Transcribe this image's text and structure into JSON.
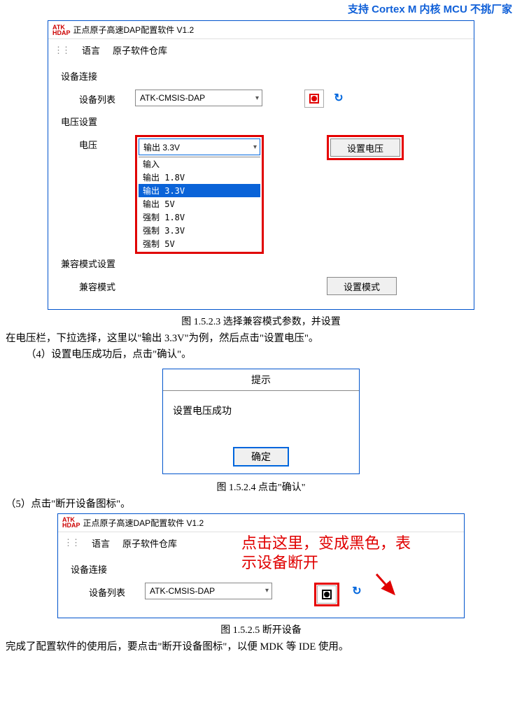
{
  "header_fragment": "支持 Cortex M 内核 MCU 不挑厂家",
  "app1": {
    "title": "正点原子高速DAP配置软件 V1.2",
    "menu": {
      "lang": "语言",
      "repo": "原子软件仓库"
    },
    "group_connect": "设备连接",
    "group_voltage": "电压设置",
    "group_compat": "兼容模式设置",
    "label_device_list": "设备列表",
    "label_voltage": "电压",
    "label_compat": "兼容模式",
    "device_value": "ATK-CMSIS-DAP",
    "voltage_value": "输出 3.3V",
    "voltage_options": [
      "输入",
      "输出 1.8V",
      "输出 3.3V",
      "输出 5V",
      "强制 1.8V",
      "强制 3.3V",
      "强制 5V"
    ],
    "btn_set_voltage": "设置电压",
    "btn_set_mode": "设置模式"
  },
  "caption1": "图 1.5.2.3 选择兼容模式参数，并设置",
  "para1": "在电压栏，下拉选择，这里以\"输出 3.3V\"为例，然后点击\"设置电压\"。",
  "para2": "（4）设置电压成功后，点击\"确认\"。",
  "dialog": {
    "title": "提示",
    "message": "设置电压成功",
    "ok": "确定"
  },
  "caption2": "图 1.5.2.4 点击\"确认\"",
  "para3": "（5）点击\"断开设备图标\"。",
  "app2": {
    "title": "正点原子高速DAP配置软件 V1.2",
    "menu": {
      "lang": "语言",
      "repo": "原子软件仓库"
    },
    "group_connect": "设备连接",
    "label_device_list": "设备列表",
    "device_value": "ATK-CMSIS-DAP",
    "annotation": "点击这里，变成黑色，表\n示设备断开"
  },
  "caption3": "图 1.5.2.5 断开设备",
  "para4": "完成了配置软件的使用后，要点击\"断开设备图标\"，以便 MDK 等 IDE 使用。"
}
